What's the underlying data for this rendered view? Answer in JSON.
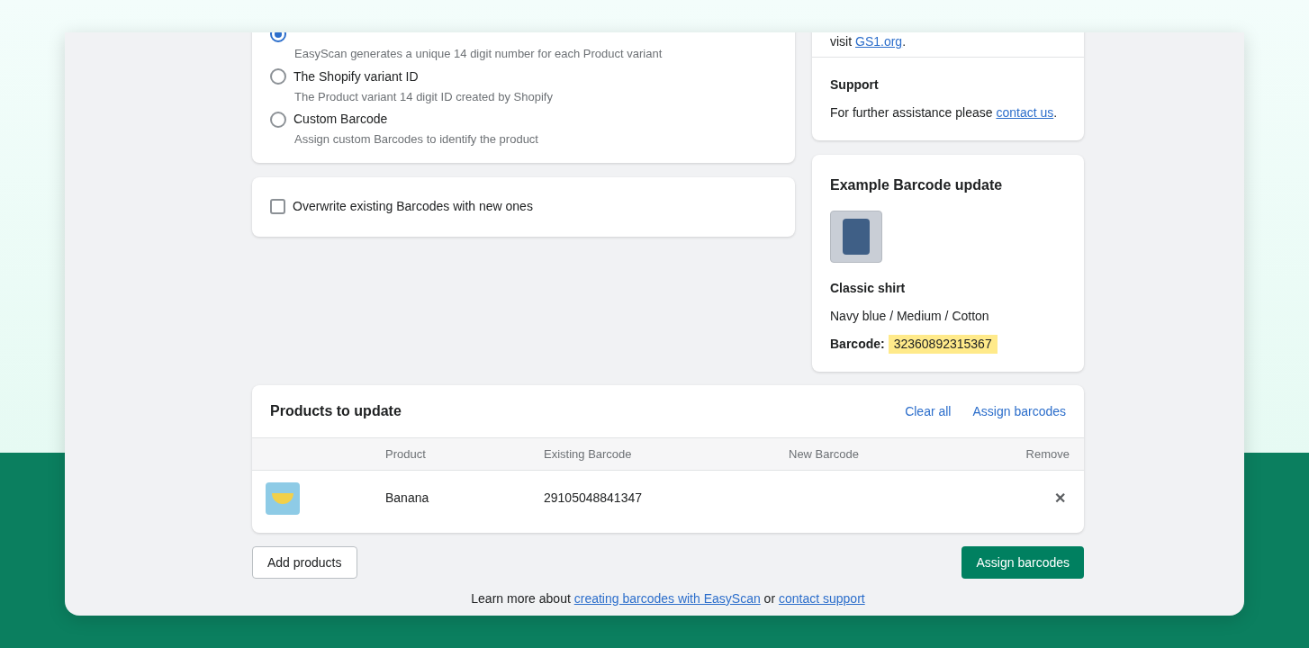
{
  "barcode_options": [
    {
      "description": "EasyScan generates a unique 14 digit number for each Product variant",
      "selected": true
    },
    {
      "label": "The Shopify variant ID",
      "description": "The Product variant 14 digit ID created by Shopify",
      "selected": false
    },
    {
      "label": "Custom Barcode",
      "description": "Assign custom Barcodes to identify the product",
      "selected": false
    }
  ],
  "overwrite": {
    "label": "Overwrite existing Barcodes with new ones",
    "checked": false
  },
  "info": {
    "visit_text": "visit",
    "visit_link": "GS1.org",
    "visit_end": ".",
    "support_title": "Support",
    "support_text": "For further assistance please",
    "support_link": "contact us",
    "support_end": "."
  },
  "example": {
    "title": "Example Barcode update",
    "product": "Classic shirt",
    "variant": "Navy blue / Medium / Cotton",
    "barcode_label": "Barcode:",
    "barcode": "32360892315367"
  },
  "products": {
    "title": "Products to update",
    "actions": [
      "Clear all",
      "Assign barcodes"
    ],
    "columns": [
      "Product",
      "Existing Barcode",
      "New Barcode",
      "Remove"
    ],
    "rows": [
      {
        "product": "Banana",
        "existing_barcode": "29105048841347",
        "remove": "✕"
      }
    ]
  },
  "buttons": {
    "add": "Add products",
    "assign": "Assign barcodes"
  },
  "footer": {
    "text": "Learn more about",
    "link1": "creating barcodes with EasyScan",
    "middle": "or",
    "link2": "contact support"
  }
}
